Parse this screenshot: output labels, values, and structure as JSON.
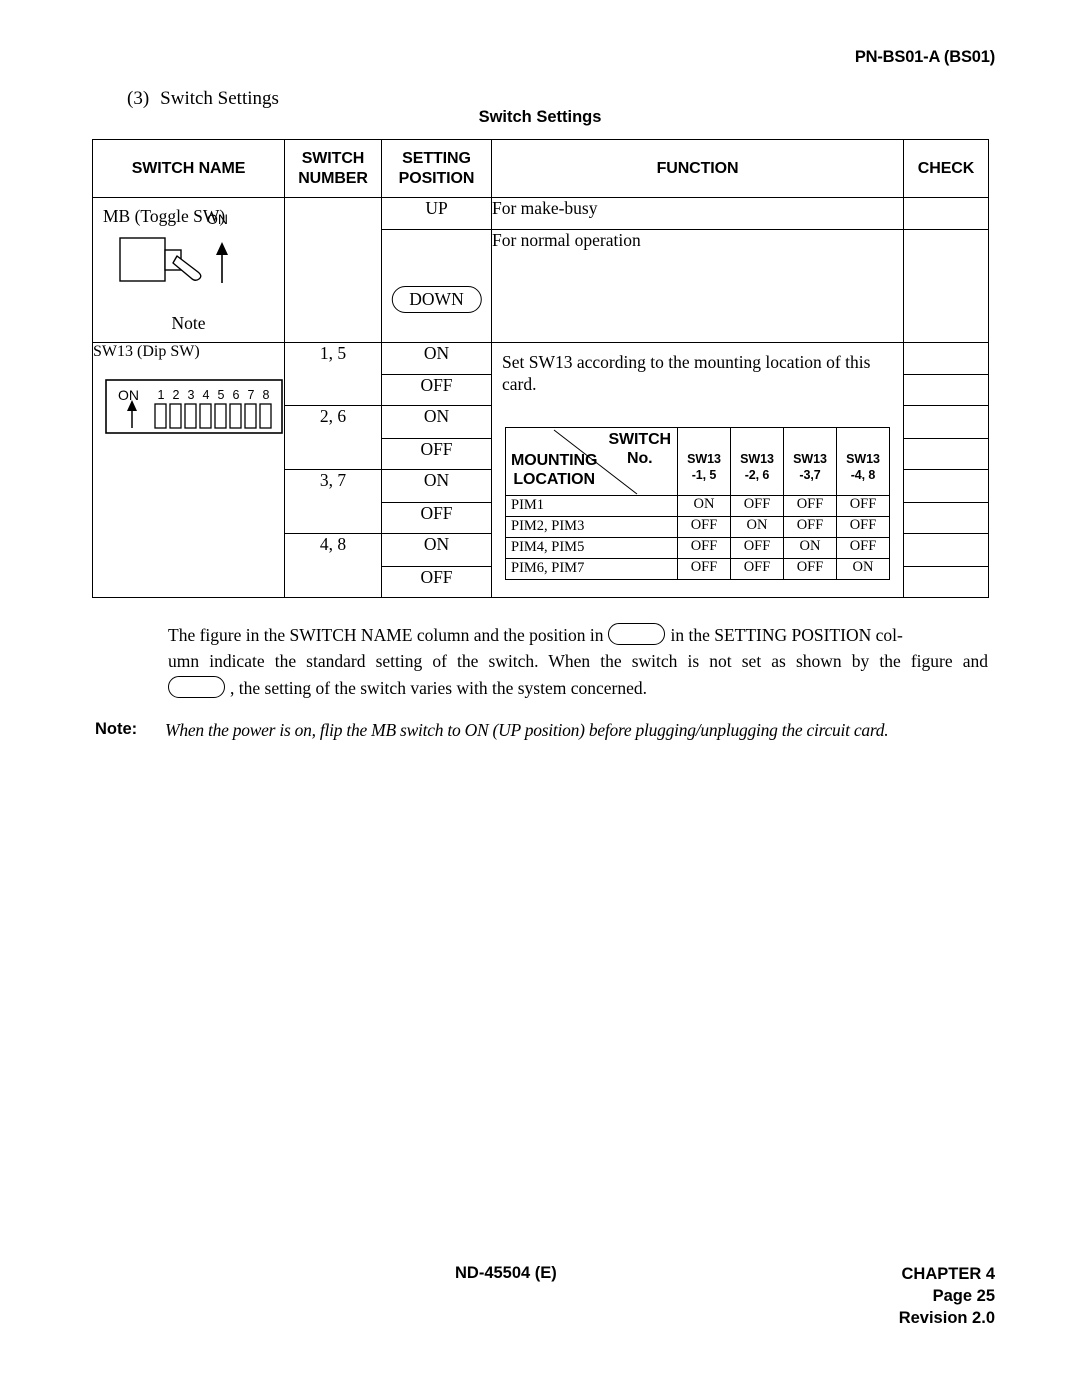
{
  "header": {
    "card_id": "PN-BS01-A (BS01)"
  },
  "section": {
    "number": "(3)",
    "title": "Switch Settings"
  },
  "table_caption": "Switch Settings",
  "main_table": {
    "columns": {
      "switch_name": "SWITCH NAME",
      "switch_number_line1": "SWITCH",
      "switch_number_line2": "NUMBER",
      "setting_position_line1": "SETTING",
      "setting_position_line2": "POSITION",
      "function": "FUNCTION",
      "check": "CHECK"
    },
    "rows": [
      {
        "switch_name": "MB (Toggle SW)",
        "switch_name_note": "Note",
        "figure": "toggle-switch",
        "figure_on_label": "ON",
        "switch_number": "",
        "positions": [
          {
            "label": "UP",
            "highlighted": false,
            "function": "For make-busy"
          },
          {
            "label": "DOWN",
            "highlighted": true,
            "function": "For normal operation"
          }
        ]
      },
      {
        "switch_name": "SW13 (Dip SW)",
        "figure": "dip-switch",
        "figure_on_label": "ON",
        "figure_pin_labels": [
          "1",
          "2",
          "3",
          "4",
          "5",
          "6",
          "7",
          "8"
        ],
        "function": "Set SW13 according to the mounting location of this card.",
        "groups": [
          {
            "switch_number": "1, 5",
            "positions": [
              "ON",
              "OFF"
            ]
          },
          {
            "switch_number": "2, 6",
            "positions": [
              "ON",
              "OFF"
            ]
          },
          {
            "switch_number": "3, 7",
            "positions": [
              "ON",
              "OFF"
            ]
          },
          {
            "switch_number": "4, 8",
            "positions": [
              "ON",
              "OFF"
            ]
          }
        ]
      }
    ]
  },
  "inner_table": {
    "corner_top_right_line1": "SWITCH",
    "corner_top_right_line2": "No.",
    "corner_bottom_left_line1": "MOUNTING",
    "corner_bottom_left_line2": "LOCATION",
    "columns": [
      {
        "line1": "SW13",
        "line2": "-1, 5"
      },
      {
        "line1": "SW13",
        "line2": "-2, 6"
      },
      {
        "line1": "SW13",
        "line2": "-3,7"
      },
      {
        "line1": "SW13",
        "line2": "-4, 8"
      }
    ],
    "rows": [
      {
        "location": "PIM1",
        "values": [
          "ON",
          "OFF",
          "OFF",
          "OFF"
        ]
      },
      {
        "location": "PIM2, PIM3",
        "values": [
          "OFF",
          "ON",
          "OFF",
          "OFF"
        ]
      },
      {
        "location": "PIM4, PIM5",
        "values": [
          "OFF",
          "OFF",
          "ON",
          "OFF"
        ]
      },
      {
        "location": "PIM6, PIM7",
        "values": [
          "OFF",
          "OFF",
          "OFF",
          "ON"
        ]
      }
    ]
  },
  "explanation": {
    "line1_a": "The figure in the SWITCH NAME column and the position in",
    "line1_b": "in the SETTING POSITION col-",
    "line2": "umn indicate the standard setting of the switch. When the switch is not set as shown by the figure and",
    "line3": ", the setting of the switch varies with the system concerned."
  },
  "note": {
    "label": "Note:",
    "text": "When the power is on, flip the MB switch to ON (UP position) before plugging/unplugging the circuit card."
  },
  "footer": {
    "document_id": "ND-45504 (E)",
    "chapter": "CHAPTER 4",
    "page": "Page 25",
    "revision": "Revision 2.0"
  }
}
